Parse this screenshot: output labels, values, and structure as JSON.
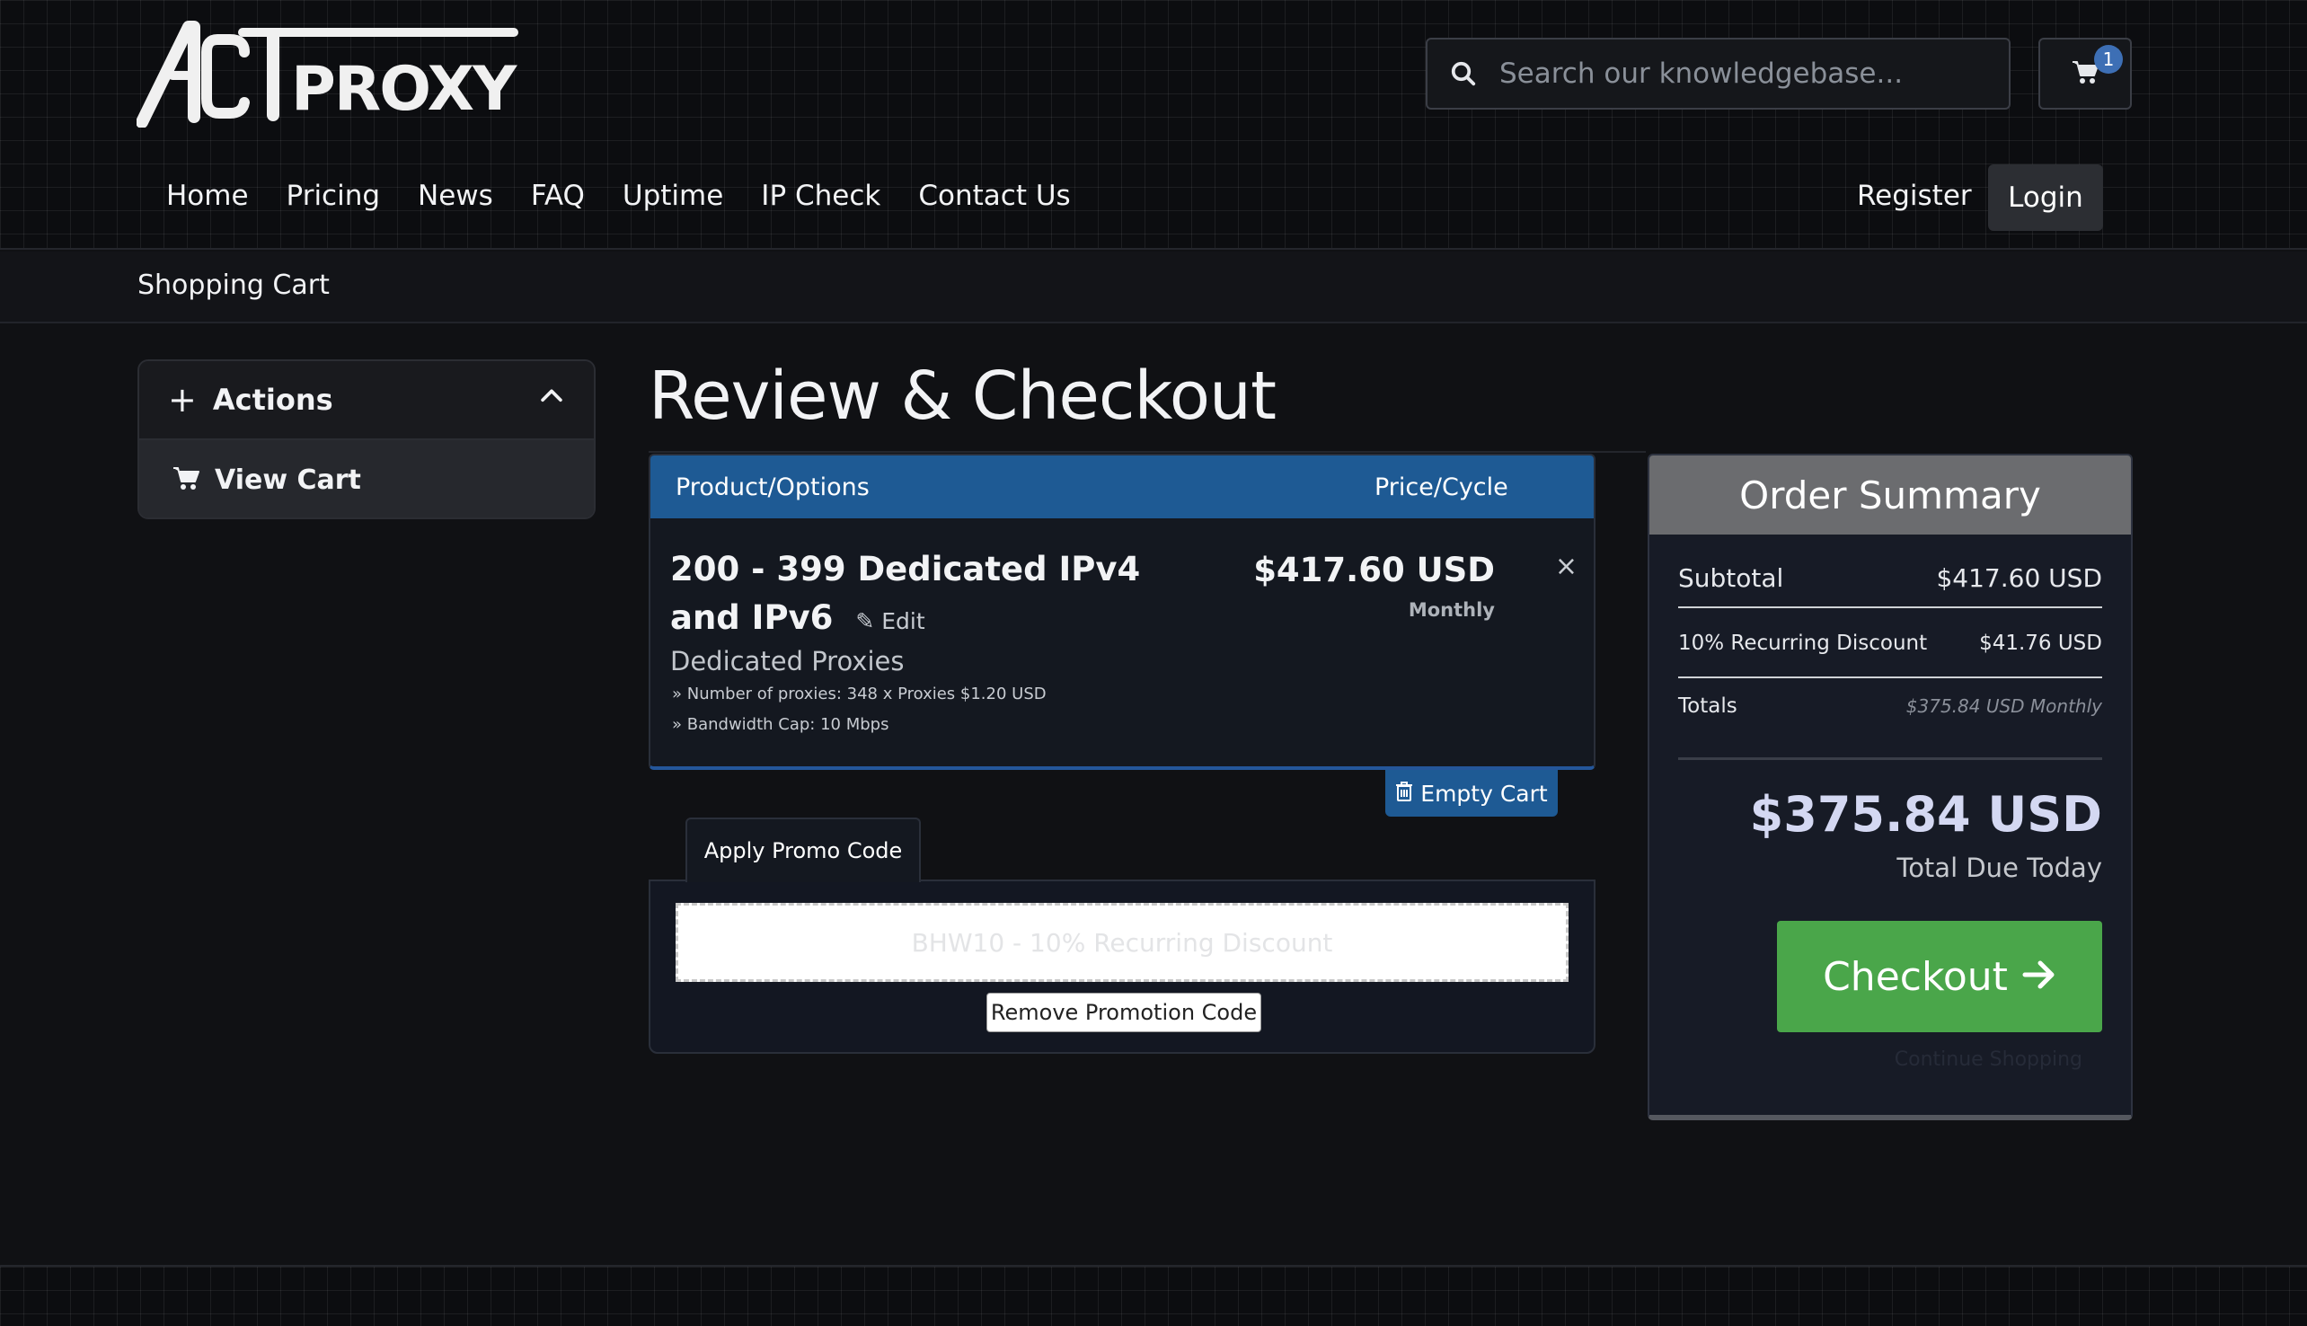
{
  "brand": {
    "logo_text": "ACTPROXY"
  },
  "search": {
    "placeholder": "Search our knowledgebase..."
  },
  "cart": {
    "badge_count": "1"
  },
  "nav": {
    "items": [
      "Home",
      "Pricing",
      "News",
      "FAQ",
      "Uptime",
      "IP Check",
      "Contact Us"
    ],
    "register": "Register",
    "login": "Login"
  },
  "breadcrumb": "Shopping Cart",
  "sidebar": {
    "header": "Actions",
    "items": [
      "View Cart"
    ]
  },
  "page_title": "Review & Checkout",
  "cart_table": {
    "col_product": "Product/Options",
    "col_price": "Price/Cycle",
    "product_name": "200 - 399 Dedicated IPv4 and IPv6",
    "edit_label": "Edit",
    "product_group": "Dedicated Proxies",
    "options": [
      "» Number of proxies: 348 x Proxies $1.20 USD",
      "» Bandwidth Cap: 10 Mbps"
    ],
    "price": "$417.60 USD",
    "cycle": "Monthly",
    "remove_symbol": "×"
  },
  "empty_cart": "Empty Cart",
  "promo": {
    "tab_label": "Apply Promo Code",
    "applied_code": "BHW10 - 10% Recurring Discount",
    "remove_label": "Remove Promotion Code"
  },
  "summary": {
    "title": "Order Summary",
    "subtotal_label": "Subtotal",
    "subtotal_value": "$417.60 USD",
    "discount_label": "10% Recurring Discount",
    "discount_value": "$41.76 USD",
    "totals_label": "Totals",
    "totals_value": "$375.84 USD Monthly",
    "total_due": "$375.84 USD",
    "total_due_label": "Total Due Today",
    "checkout_label": "Checkout",
    "continue_label": "Continue Shopping"
  },
  "colors": {
    "accent_blue": "#1e5a94",
    "checkout_green": "#4aa64a",
    "summary_header": "#6b6c6f"
  }
}
